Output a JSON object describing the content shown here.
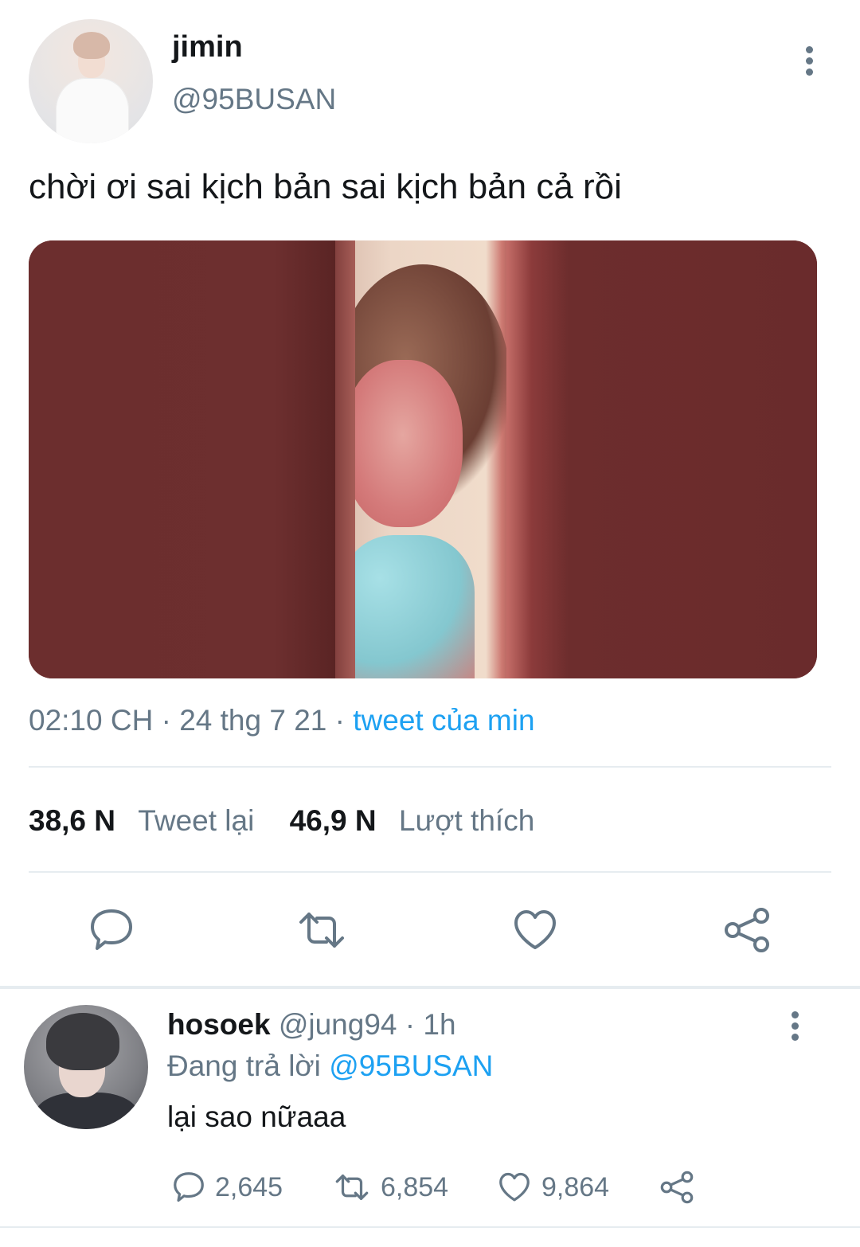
{
  "tweet": {
    "display_name": "jimin",
    "handle": "@95BUSAN",
    "text": "chời ơi sai kịch bản sai kịch bản cả rồi",
    "time": "02:10 CH",
    "date": "24 thg 7 21",
    "source": "tweet của min",
    "retweet_count": "38,6 N",
    "retweet_label": "Tweet lại",
    "like_count": "46,9 N",
    "like_label": "Lượt thích",
    "actions": [
      "reply-icon",
      "retweet-icon",
      "like-icon",
      "share-icon"
    ]
  },
  "reply": {
    "display_name": "hosoek",
    "handle": "@jung94",
    "time": "1h",
    "replying_prefix": "Đang trả lời",
    "replying_to": "@95BUSAN",
    "text": "lại sao nữaaa",
    "reply_count": "2,645",
    "retweet_count": "6,854",
    "like_count": "9,864"
  },
  "colors": {
    "link": "#1da1f2",
    "secondary": "#657786",
    "primary": "#14171a",
    "divider": "#e6ecf0"
  }
}
